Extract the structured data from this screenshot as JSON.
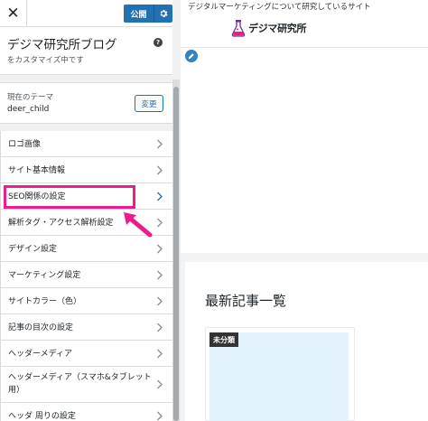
{
  "header": {
    "close_symbol": "✕",
    "publish_label": "公開"
  },
  "site": {
    "title": "デジマ研究所ブログ",
    "subtitle": "をカスタマイズ中です"
  },
  "theme": {
    "label": "現在のテーマ",
    "name": "deer_child",
    "change_label": "変更"
  },
  "menu": {
    "items": [
      {
        "label": "ロゴ画像"
      },
      {
        "label": "サイト基本情報"
      },
      {
        "label": "SEO関係の設定"
      },
      {
        "label": "解析タグ・アクセス解析設定"
      },
      {
        "label": "デザイン設定"
      },
      {
        "label": "マーケティング設定"
      },
      {
        "label": "サイトカラー（色）"
      },
      {
        "label": "記事の目次の設定"
      },
      {
        "label": "ヘッダーメディア"
      },
      {
        "label": "ヘッダーメディア（スマホ&タブレット用）"
      },
      {
        "label": "ヘッダ  周りの設定"
      }
    ]
  },
  "preview": {
    "tagline": "デジタルマーケティングについて研究しているサイト",
    "logo_text": "デジマ研究所",
    "recent_title": "最新記事一覧",
    "category_badge": "未分類"
  },
  "colors": {
    "accent": "#2271b1",
    "highlight": "#ec1c8a",
    "thumbnail": "#e3f3fc"
  },
  "icons": [
    "close-icon",
    "gear-icon",
    "help-icon",
    "chevron-right-icon",
    "pencil-icon",
    "flask-logo-icon"
  ]
}
